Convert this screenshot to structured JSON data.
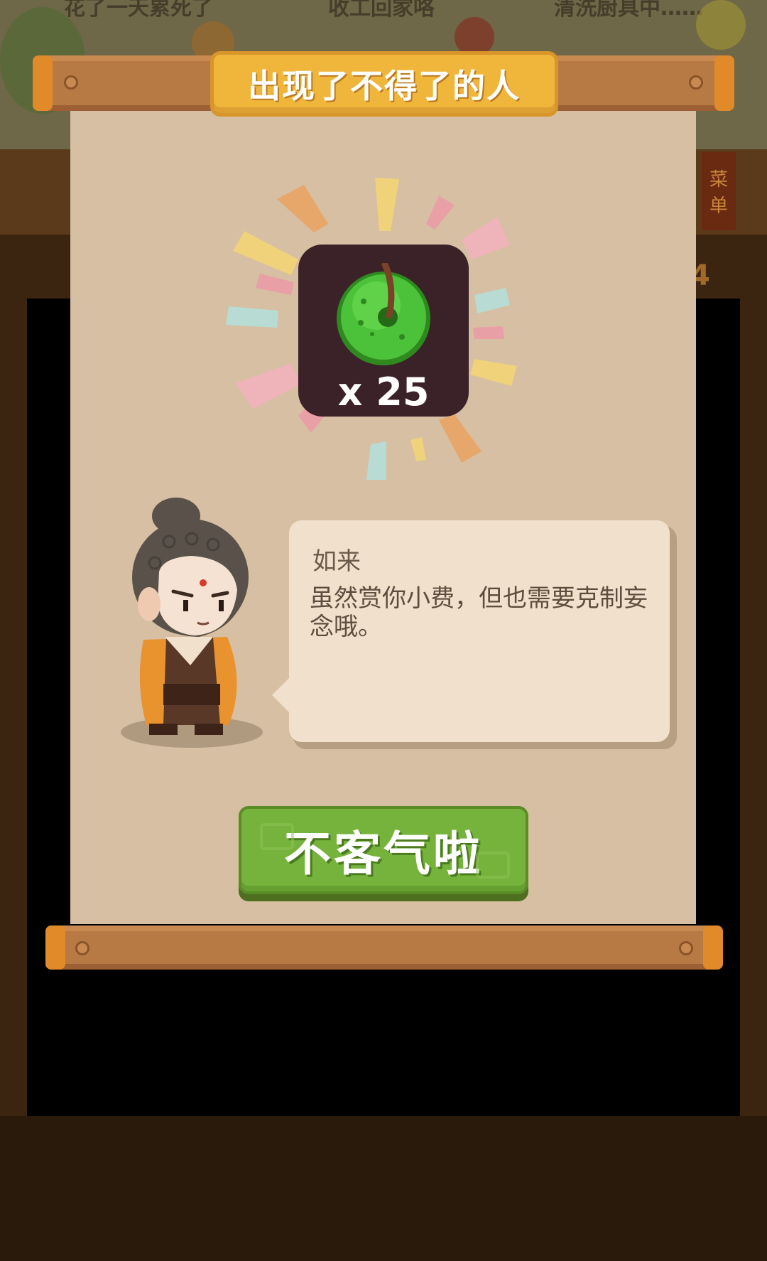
{
  "background": {
    "status_left": "花了一天累死了",
    "status_mid": "收工回家咯",
    "status_right": "清洗厨具中……",
    "menu_label": "菜单",
    "badge": "4"
  },
  "dialog": {
    "title": "出现了不得了的人",
    "reward": {
      "icon": "green-fruit-icon",
      "count": "x 25"
    },
    "speaker": "如来",
    "message": "虽然赏你小费，但也需要克制妄念哦。",
    "button_label": "不客气啦"
  },
  "colors": {
    "paper": "#d6bfa2",
    "title_plate": "#f0b53b",
    "button": "#76b33c",
    "bubble": "#f1e0cb"
  }
}
